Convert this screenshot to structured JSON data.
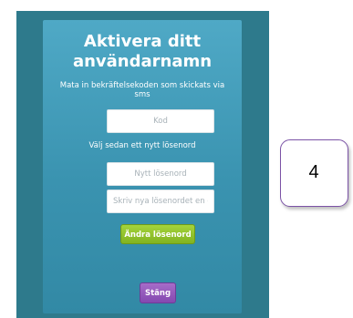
{
  "dialog": {
    "title_line1": "Aktivera ditt",
    "title_line2": "användarnamn",
    "instructions": "Mata in bekräftelsekoden som skickats via sms",
    "code_placeholder": "Kod",
    "new_password_label": "Välj sedan ett nytt lösenord",
    "new_password_placeholder": "Nytt lösenord",
    "repeat_password_placeholder": "Skriv nya lösenordet en gång till",
    "change_password_label": "Ändra lösenord",
    "close_label": "Stäng"
  },
  "annotation": {
    "number": "4"
  },
  "colors": {
    "background": "#2e7a8c",
    "panel": "#4fa9c6",
    "change_button": "#8cc02a",
    "close_button": "#9159bb",
    "annotation_border": "#7b53a6"
  }
}
